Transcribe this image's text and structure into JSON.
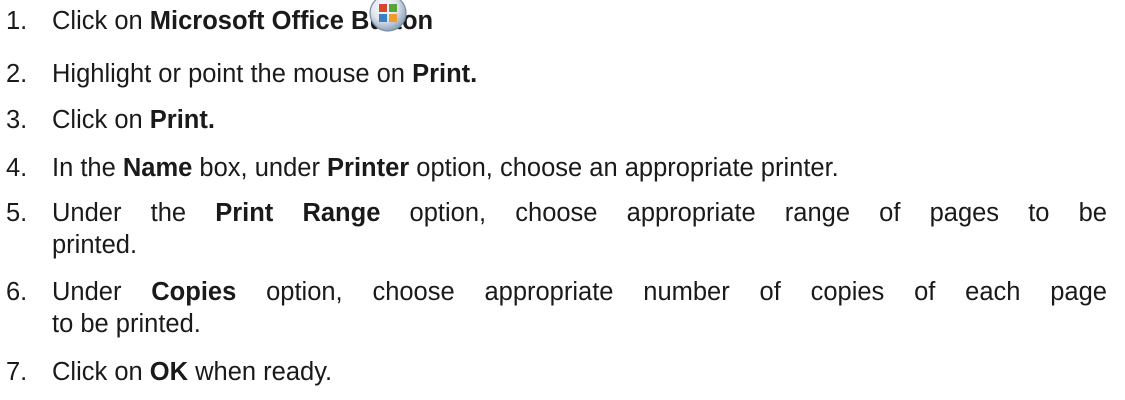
{
  "steps": [
    {
      "num": "1.",
      "pre": "Click on ",
      "b1": "Microsoft Office Button",
      "icon": "microsoft-office-button-icon"
    },
    {
      "num": "2.",
      "pre": "Highlight or point the mouse on ",
      "b1": "Print."
    },
    {
      "num": "3.",
      "pre": "Click on ",
      "b1": "Print."
    },
    {
      "num": "4.",
      "pre": "In the ",
      "b1": "Name",
      "mid": " box, under ",
      "b2": "Printer",
      "post": " option, choose an appropriate printer."
    },
    {
      "num": "5.",
      "pre": "Under the ",
      "b1": "Print Range",
      "post": " option, choose appropriate range of pages to be",
      "cont": "printed."
    },
    {
      "num": "6.",
      "pre": "Under ",
      "b1": "Copies",
      "post": " option, choose appropriate number of copies of each page",
      "cont": "to be printed."
    },
    {
      "num": "7.",
      "pre": "Click on ",
      "b1": "OK",
      "post": " when ready."
    }
  ],
  "colors": {
    "text": "#1a1a1a",
    "office_orange": "#f29a2e",
    "office_blue": "#3d7fc4",
    "office_green": "#5aa33b",
    "office_red": "#d9462c"
  }
}
